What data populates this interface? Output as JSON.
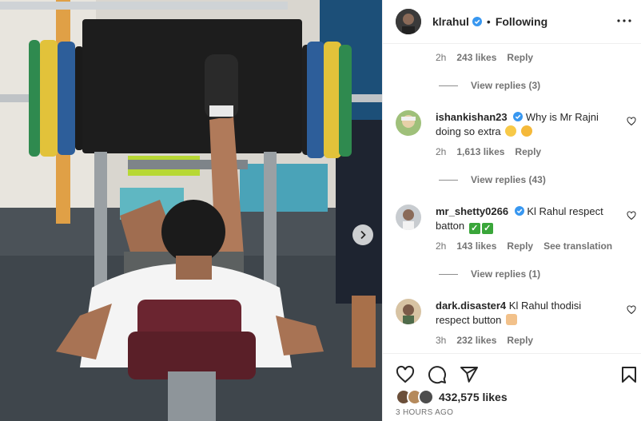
{
  "post": {
    "username": "klrahul",
    "separator": "•",
    "follow_state": "Following",
    "next_icon": "chevron-right-icon",
    "more_icon": "more-horizontal-icon"
  },
  "comments_top": {
    "time": "2h",
    "likes": "243 likes",
    "reply": "Reply",
    "view_replies": "View replies (3)"
  },
  "comments": [
    {
      "username": "ishankishan23",
      "text": "Why is Mr Rajni doing so extra",
      "emoji": [
        "laughing-crying-emoji",
        "winking-tongue-emoji"
      ],
      "time": "2h",
      "likes": "1,613 likes",
      "reply": "Reply",
      "view_replies": "View replies (43)"
    },
    {
      "username": "mr_shetty0266",
      "text": "Kl Rahul respect",
      "text2": "batton",
      "emoji": [
        "check-mark-button",
        "check-mark-button"
      ],
      "time": "2h",
      "likes": "143 likes",
      "reply": "Reply",
      "translation": "See translation",
      "view_replies": "View replies (1)"
    },
    {
      "username": "dark.disaster4",
      "text": "Kl Rahul thodisi",
      "text2": "respect button",
      "emoji": [
        "pointing-hand-emoji"
      ],
      "time": "3h",
      "likes": "232 likes",
      "reply": "Reply"
    }
  ],
  "actions": {
    "icons": [
      "heart-icon",
      "comment-icon",
      "share-icon",
      "bookmark-icon"
    ],
    "likes": "432,575 likes",
    "time_ago": "3 HOURS AGO"
  },
  "colors": {
    "verified": "#3897f0",
    "text": "#262626",
    "secondary": "#737373"
  }
}
